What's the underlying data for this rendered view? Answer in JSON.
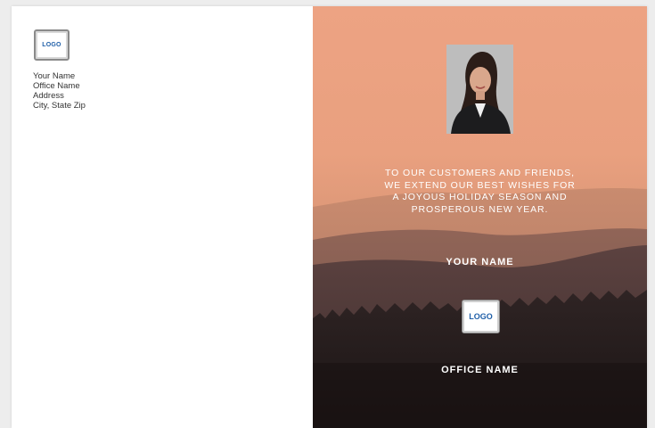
{
  "left": {
    "logo_text": "LOGO",
    "address_lines": [
      "Your Name",
      "Office Name",
      "Address",
      "City, State Zip"
    ]
  },
  "right": {
    "greeting_lines": [
      "TO OUR CUSTOMERS AND FRIENDS,",
      "WE EXTEND OUR BEST WISHES FOR",
      "A JOYOUS HOLIDAY SEASON AND",
      "PROSPEROUS NEW YEAR."
    ],
    "your_name": "YOUR NAME",
    "logo_text": "LOGO",
    "office_name": "OFFICE NAME"
  },
  "colors": {
    "sky": "#e4a07e",
    "logo_text": "#1f5fa8"
  }
}
